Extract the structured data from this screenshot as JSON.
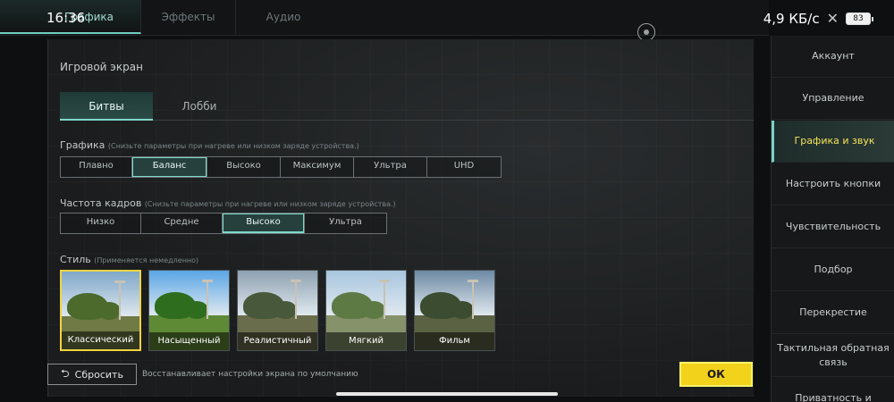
{
  "status_bar": {
    "time": "16:36",
    "network": "4,9 КБ/с",
    "battery": "83",
    "x_glyph": "✕"
  },
  "top_tabs": [
    "Графика",
    "Эффекты",
    "Аудио"
  ],
  "screen_title": "Игровой экран",
  "sub_tabs": [
    "Битвы",
    "Лобби"
  ],
  "graphics": {
    "label": "Графика",
    "hint": "(Снизьте параметры при нагреве или низком заряде устройства.)",
    "options": [
      "Плавно",
      "Баланс",
      "Высоко",
      "Максимум",
      "Ультра",
      "UHD"
    ],
    "selected": "Баланс"
  },
  "frame_rate": {
    "label": "Частота кадров",
    "hint": "(Снизьте параметры при нагреве или низком заряде устройства.)",
    "options": [
      "Низко",
      "Средне",
      "Высоко",
      "Ультра"
    ],
    "selected": "Высоко"
  },
  "style": {
    "label": "Стиль",
    "hint": "(Применяется немедленно)",
    "cards": [
      {
        "label": "Классический",
        "sky": "#7fa7c9",
        "ground": "#6f7a45",
        "tree": "#4b6a2c"
      },
      {
        "label": "Насыщенный",
        "sky": "#5aa6e6",
        "ground": "#5f8a35",
        "tree": "#2f6d1e"
      },
      {
        "label": "Реалистичный",
        "sky": "#8ea1b1",
        "ground": "#6a6d4c",
        "tree": "#48583a"
      },
      {
        "label": "Мягкий",
        "sky": "#a8c6df",
        "ground": "#86926a",
        "tree": "#5d7a45"
      },
      {
        "label": "Фильм",
        "sky": "#6d8aa3",
        "ground": "#5b6244",
        "tree": "#3b4c30"
      }
    ],
    "selected": "Классический"
  },
  "bottom": {
    "reset_label": "Сбросить",
    "reset_icon": "⮌",
    "reset_hint": "Восстанавливает настройки экрана по умолчанию",
    "ok_label": "ОК"
  },
  "sidebar": {
    "items": [
      "Аккаунт",
      "Управление",
      "Графика и звук",
      "Настроить кнопки",
      "Чувствительность",
      "Подбор",
      "Перекрестие",
      "Тактильная обратная связь",
      "Приватность и"
    ],
    "selected": "Графика и звук"
  }
}
